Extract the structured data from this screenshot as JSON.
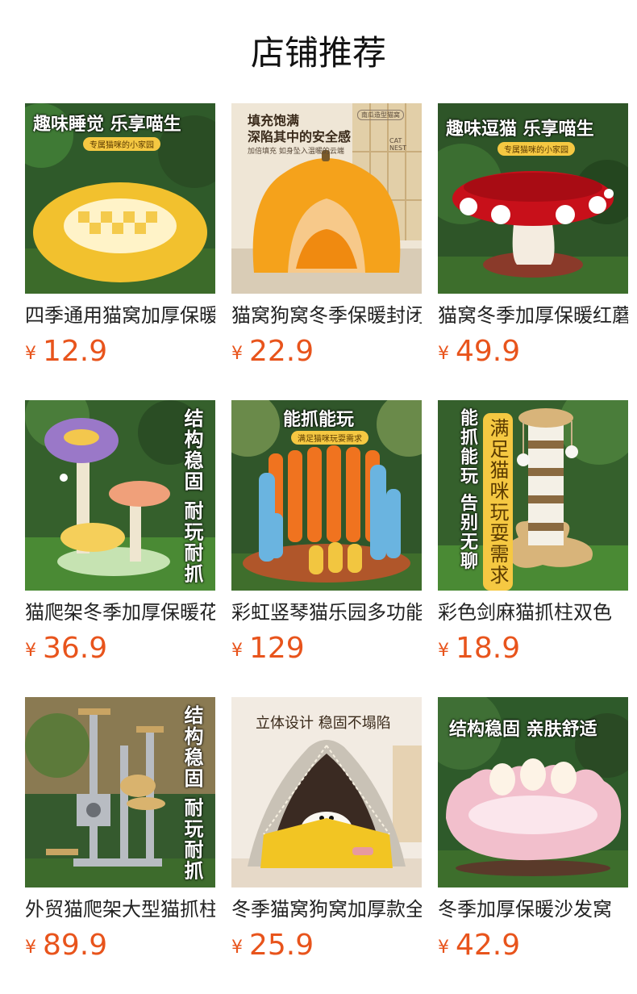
{
  "page": {
    "title": "店铺推荐"
  },
  "products": [
    {
      "name": "四季通用猫窝加厚保暖",
      "price": "12.9",
      "currency": "¥",
      "overlay": {
        "headline": "趣味睡觉 乐享喵生",
        "tag": "专属猫咪的小家园"
      }
    },
    {
      "name": "猫窝狗窝冬季保暖封闭",
      "price": "22.9",
      "currency": "¥",
      "overlay": {
        "headline_line1": "填充饱满",
        "headline_line2": "深陷其中的安全感",
        "sub": "加倍填充 如身坠入温暖的云端",
        "badge": "南瓜造型猫窝",
        "corner": "CAT NEST"
      }
    },
    {
      "name": "猫窝冬季加厚保暖红蘑菇",
      "price": "49.9",
      "currency": "¥",
      "overlay": {
        "headline": "趣味逗猫 乐享喵生",
        "tag": "专属猫咪的小家园"
      }
    },
    {
      "name": "猫爬架冬季加厚保暖花朵",
      "price": "36.9",
      "currency": "¥",
      "overlay": {
        "vertical": "结构稳固 耐玩耐抓"
      }
    },
    {
      "name": "彩虹竖琴猫乐园多功能",
      "price": "129",
      "currency": "¥",
      "overlay": {
        "headline": "能抓能玩",
        "tag": "满足猫咪玩耍需求"
      }
    },
    {
      "name": "彩色剑麻猫抓柱双色",
      "price": "18.9",
      "currency": "¥",
      "overlay": {
        "vertical": "能抓能玩 告别无聊",
        "tag": "满足猫咪玩耍需求"
      }
    },
    {
      "name": "外贸猫爬架大型猫抓柱",
      "price": "89.9",
      "currency": "¥",
      "overlay": {
        "vertical": "结构稳固 耐玩耐抓"
      }
    },
    {
      "name": "冬季猫窝狗窝加厚款全封闭",
      "price": "25.9",
      "currency": "¥",
      "overlay": {
        "headline": "立体设计  稳固不塌陷"
      }
    },
    {
      "name": "冬季加厚保暖沙发窝",
      "price": "42.9",
      "currency": "¥",
      "overlay": {
        "headline": "结构稳固 亲肤舒适"
      }
    }
  ],
  "colors": {
    "price": "#e8541c",
    "title": "#111111"
  }
}
